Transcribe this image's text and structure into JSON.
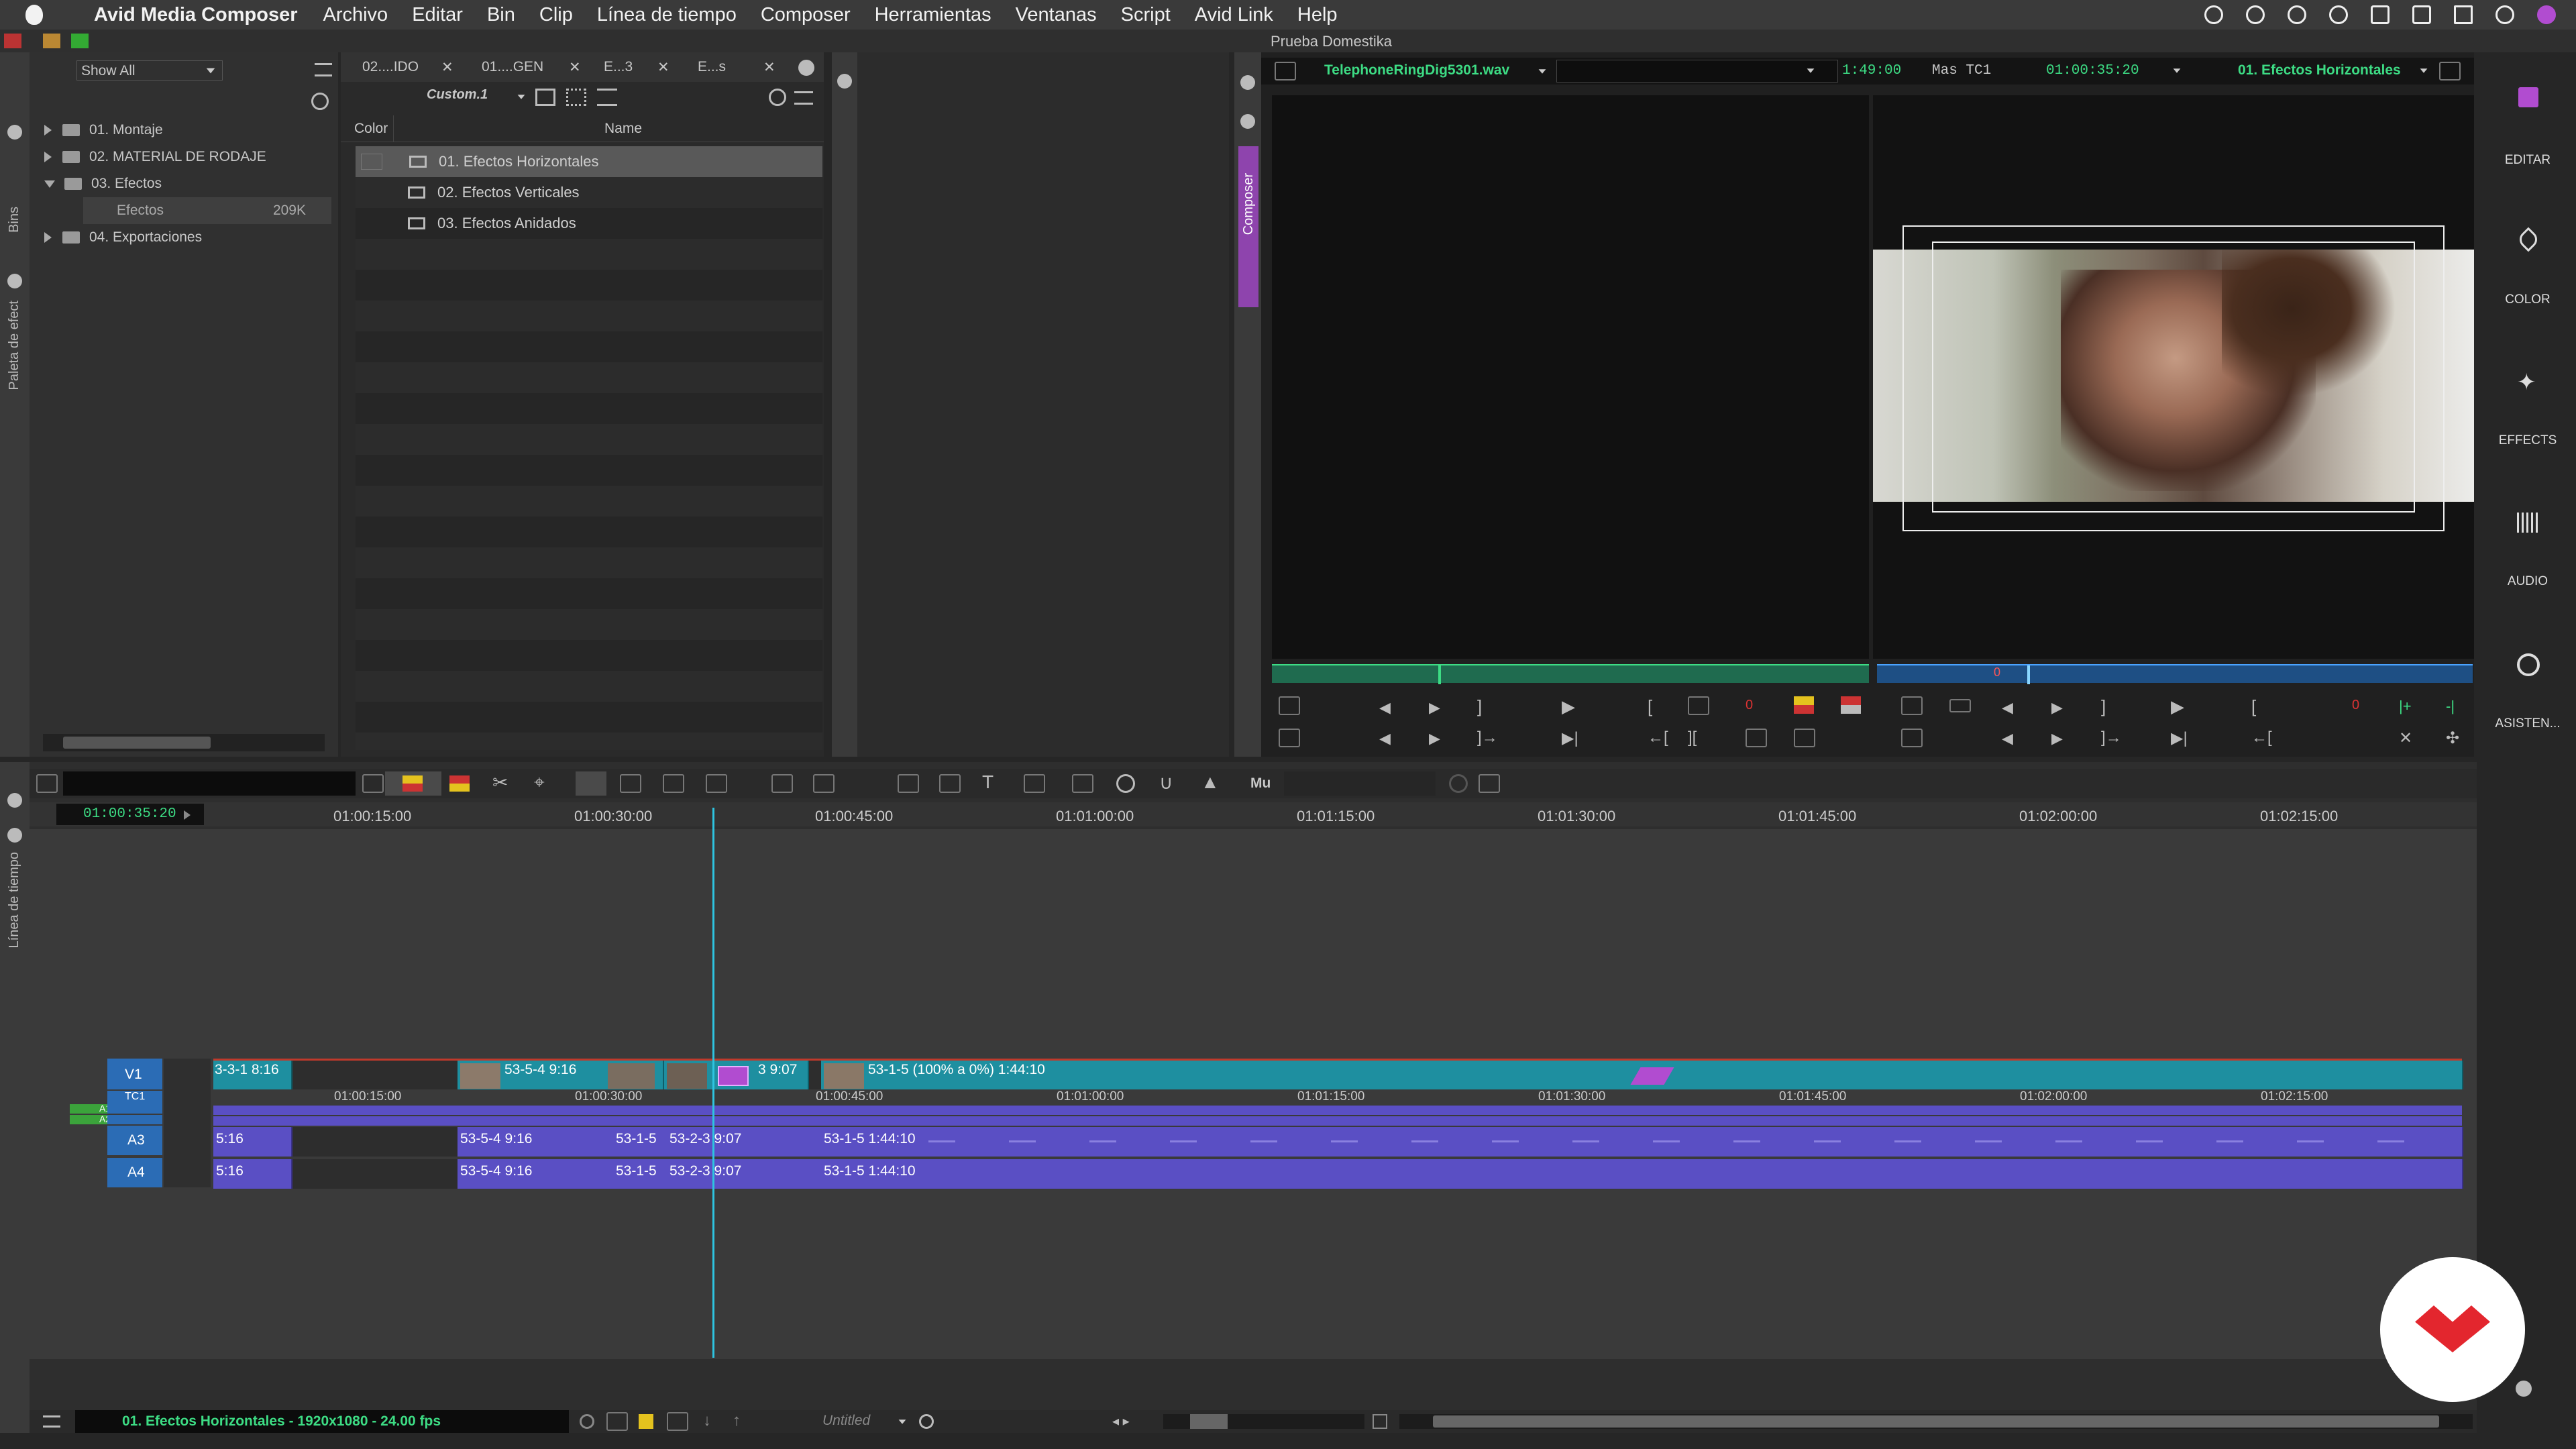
{
  "menubar": {
    "app": "Avid Media Composer",
    "items": [
      "Archivo",
      "Editar",
      "Bin",
      "Clip",
      "Línea de tiempo",
      "Composer",
      "Herramientas",
      "Ventanas",
      "Script",
      "Avid Link",
      "Help"
    ]
  },
  "bins_panel": {
    "show_select": "Show All",
    "side_tabs": [
      "Bins",
      "Paleta de efect"
    ],
    "tree": [
      {
        "label": "01. Montaje",
        "size": ""
      },
      {
        "label": "02. MATERIAL DE RODAJE",
        "size": ""
      },
      {
        "label": "03. Efectos",
        "size": ""
      },
      {
        "label": "Efectos",
        "size": "209K"
      },
      {
        "label": "04. Exportaciones",
        "size": ""
      }
    ]
  },
  "bin_window": {
    "tabs": [
      "02....IDO",
      "01....GEN",
      "E...3",
      "E...s"
    ],
    "view": "Custom.1",
    "columns": {
      "color": "Color",
      "name": "Name"
    },
    "items": [
      "01. Efectos Horizontales",
      "02. Efectos Verticales",
      "03. Efectos Anidados"
    ]
  },
  "composer": {
    "window_title": "Prueba Domestika",
    "side_label": "Composer",
    "source_clip": "TelephoneRingDig5301.wav",
    "duration": "1:49:00",
    "track_label": "Mas  TC1",
    "record_tc": "01:00:35:20",
    "sequence": "01. Efectos Horizontales",
    "record_marker": "0"
  },
  "right_tools": [
    "EDITAR",
    "COLOR",
    "EFFECTS",
    "AUDIO",
    "ASISTEN..."
  ],
  "timeline": {
    "side_label": "Línea de tiempo",
    "toolbar_mu": "Mu",
    "position_tc": "01:00:35:20",
    "ruler": [
      "01:00:15:00",
      "01:00:30:00",
      "01:00:45:00",
      "01:01:00:00",
      "01:01:15:00",
      "01:01:30:00",
      "01:01:45:00",
      "01:02:00:00",
      "01:02:15:00"
    ],
    "tracks": [
      "V1",
      "TC1",
      "A1",
      "A2",
      "A3",
      "A4"
    ],
    "v1_clips": [
      "3-3-1 8:16",
      "53-5-4 9:16",
      "3 9:07",
      "53-1-5 (100% a 0%) 1:44:10"
    ],
    "tc1_ruler": [
      "01:00:15:00",
      "01:00:30:00",
      "01:00:45:00",
      "01:01:00:00",
      "01:01:15:00",
      "01:01:30:00",
      "01:01:45:00",
      "01:02:00:00",
      "01:02:15:00"
    ],
    "a3_clips": [
      "5:16",
      "53-5-4 9:16",
      "53-1-5",
      "53-2-3 9:07",
      "53-1-5 1:44:10"
    ],
    "a4_clips": [
      "5:16",
      "53-5-4 9:16",
      "53-1-5",
      "53-2-3 9:07",
      "53-1-5 1:44:10"
    ],
    "status": "01. Efectos Horizontales - 1920x1080 - 24.00 fps",
    "untitled": "Untitled"
  },
  "colors": {
    "accent_green": "#3ddc84",
    "clip_video": "#1e8fa0",
    "clip_audio": "#5a4fc4",
    "composer_purple": "#8e44ad"
  }
}
